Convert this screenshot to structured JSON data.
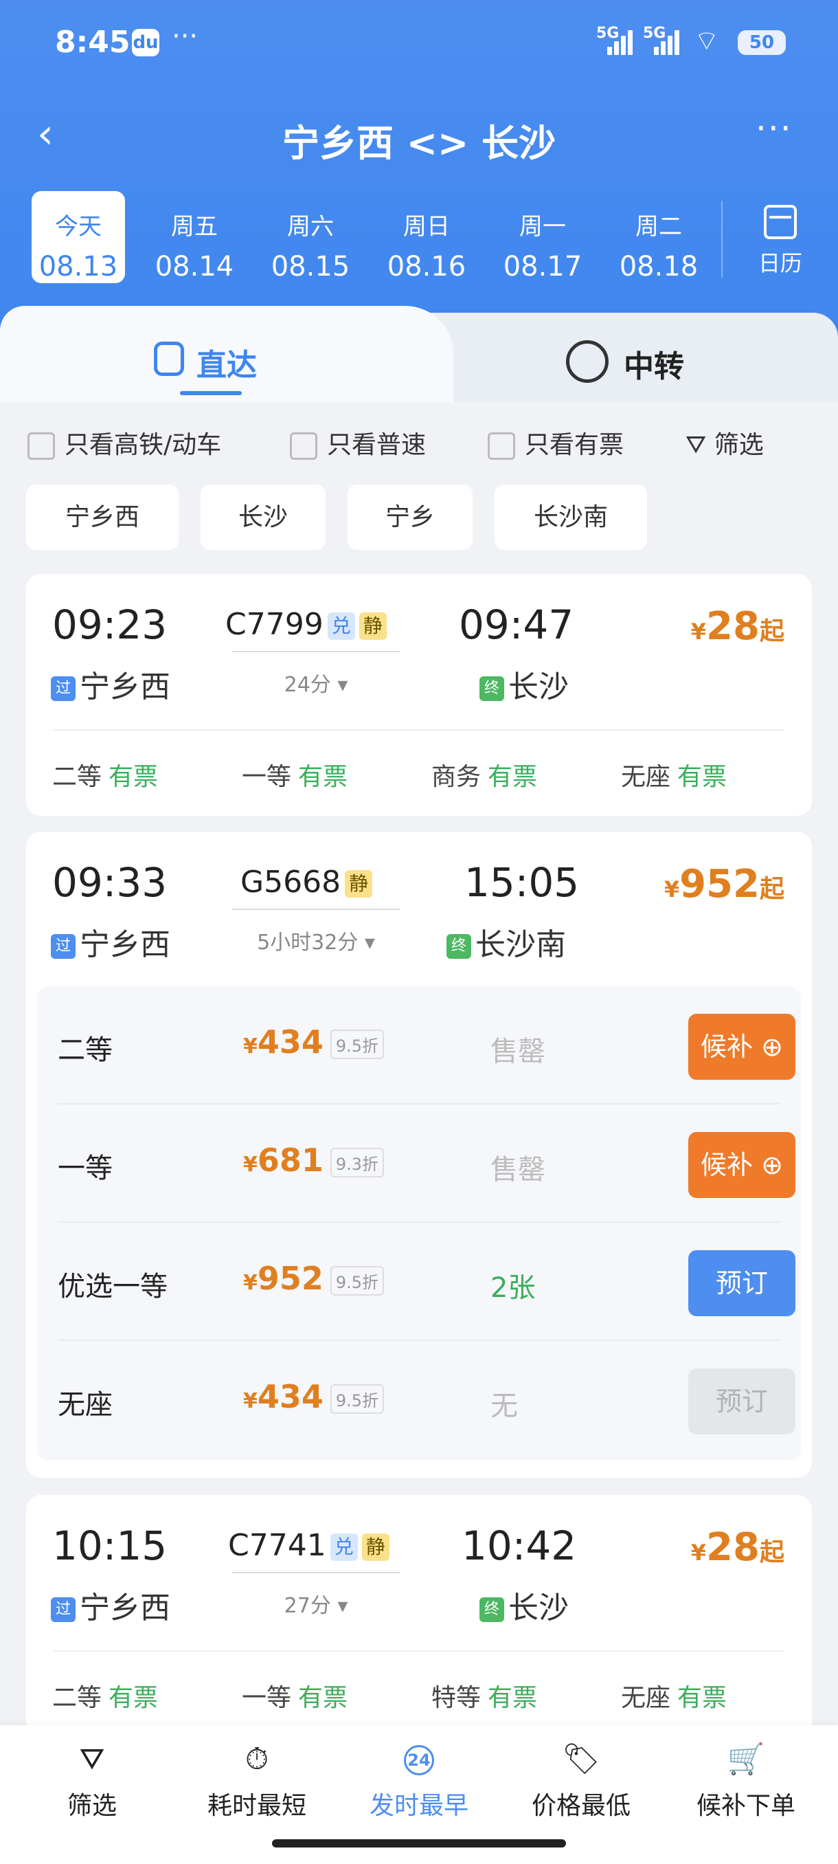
{
  "status_bar": {
    "time": "8:45",
    "extra": "···",
    "sig1": "5G",
    "sig2": "5G",
    "wifi": "6",
    "battery": "50"
  },
  "nav": {
    "back": "‹",
    "title": "宁乡西 <> 长沙",
    "more": "···"
  },
  "dates": [
    {
      "week": "今天",
      "date": "08.13",
      "selected": true
    },
    {
      "week": "周五",
      "date": "08.14"
    },
    {
      "week": "周六",
      "date": "08.15"
    },
    {
      "week": "周日",
      "date": "08.16"
    },
    {
      "week": "周一",
      "date": "08.17"
    },
    {
      "week": "周二",
      "date": "08.18"
    }
  ],
  "calendar_label": "日历",
  "tabs": {
    "direct": "直达",
    "transfer": "中转"
  },
  "filters": {
    "highspeed": "只看高铁/动车",
    "normal": "只看普速",
    "available": "只看有票",
    "filter": "筛选"
  },
  "stations": [
    "宁乡西",
    "长沙",
    "宁乡",
    "长沙南"
  ],
  "trains": [
    {
      "dep": "09:23",
      "no": "C7799",
      "badges": [
        "兑",
        "静"
      ],
      "arr": "09:47",
      "from": "宁乡西",
      "from_tag": "过",
      "duration": "24分 ▾",
      "to": "长沙",
      "to_tag": "终",
      "price_y": "¥",
      "price": "28",
      "price_q": "起",
      "seats": [
        [
          "二等",
          "有票"
        ],
        [
          "一等",
          "有票"
        ],
        [
          "商务",
          "有票"
        ],
        [
          "无座",
          "有票"
        ]
      ]
    },
    {
      "dep": "09:33",
      "no": "G5668",
      "badges": [
        "静"
      ],
      "arr": "15:05",
      "from": "宁乡西",
      "from_tag": "过",
      "duration": "5小时32分 ▾",
      "to": "长沙南",
      "to_tag": "终",
      "price_y": "¥",
      "price": "952",
      "price_q": "起",
      "detail": [
        {
          "name": "二等",
          "price": "434",
          "disc": "9.5折",
          "avail": "售罄",
          "btn": "候补 ⊕"
        },
        {
          "name": "一等",
          "price": "681",
          "disc": "9.3折",
          "avail": "售罄",
          "btn": "候补 ⊕"
        },
        {
          "name": "优选一等",
          "price": "952",
          "disc": "9.5折",
          "avail": "2张",
          "btn": "预订"
        },
        {
          "name": "无座",
          "price": "434",
          "disc": "9.5折",
          "avail": "无",
          "btn": "预订"
        }
      ]
    },
    {
      "dep": "10:15",
      "no": "C7741",
      "badges": [
        "兑",
        "静"
      ],
      "arr": "10:42",
      "from": "宁乡西",
      "from_tag": "过",
      "duration": "27分 ▾",
      "to": "长沙",
      "to_tag": "终",
      "price_y": "¥",
      "price": "28",
      "price_q": "起",
      "seats": [
        [
          "二等",
          "有票"
        ],
        [
          "一等",
          "有票"
        ],
        [
          "特等",
          "有票"
        ],
        [
          "无座",
          "有票"
        ]
      ]
    }
  ],
  "bottom_nav": [
    {
      "label": "筛选",
      "icon": "funnel-icon",
      "glyph": "⛛"
    },
    {
      "label": "耗时最短",
      "icon": "stopwatch-icon",
      "glyph": "⏱"
    },
    {
      "label": "发时最早",
      "icon": "clock-24-icon",
      "glyph": "24",
      "active": true
    },
    {
      "label": "价格最低",
      "icon": "price-tag-icon",
      "glyph": "🏷"
    },
    {
      "label": "候补下单",
      "icon": "cart-plus-icon",
      "glyph": "🛒"
    }
  ],
  "colors": {
    "primary": "#4d8ef0",
    "price": "#e07f20",
    "available": "#3cae5c",
    "waitlist": "#ef7a2a"
  }
}
